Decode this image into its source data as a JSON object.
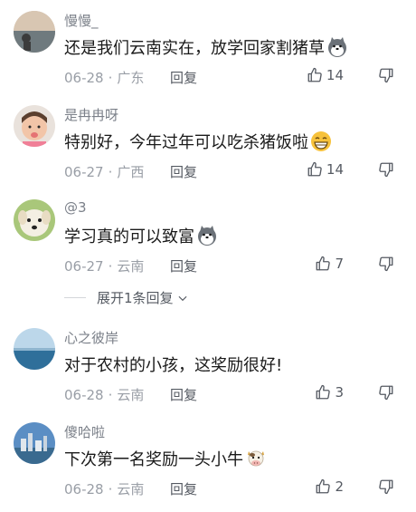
{
  "comments": [
    {
      "user": "慢慢_",
      "text": "还是我们云南实在，放学回家割猪草",
      "emoji": "dog-emoji",
      "date": "06-28",
      "region": "广东",
      "reply": "回复",
      "likes": "14"
    },
    {
      "user": "是冉冉呀",
      "text": "特别好，今年过年可以吃杀猪饭啦",
      "emoji": "grin-emoji",
      "date": "06-27",
      "region": "广西",
      "reply": "回复",
      "likes": "14"
    },
    {
      "user": "@3",
      "text": "学习真的可以致富",
      "emoji": "dog-emoji",
      "date": "06-27",
      "region": "云南",
      "reply": "回复",
      "likes": "7"
    },
    {
      "user": "心之彼岸",
      "text": "对于农村的小孩，这奖励很好!",
      "emoji": "",
      "date": "06-28",
      "region": "云南",
      "reply": "回复",
      "likes": "3"
    },
    {
      "user": "傻哈啦",
      "text": "下次第一名奖励一头小牛",
      "emoji": "cow-emoji",
      "date": "06-28",
      "region": "云南",
      "reply": "回复",
      "likes": "2"
    }
  ],
  "expand_replies": "展开1条回复",
  "colors": {
    "accent": "#1a1a1a",
    "muted": "#999ea6"
  }
}
